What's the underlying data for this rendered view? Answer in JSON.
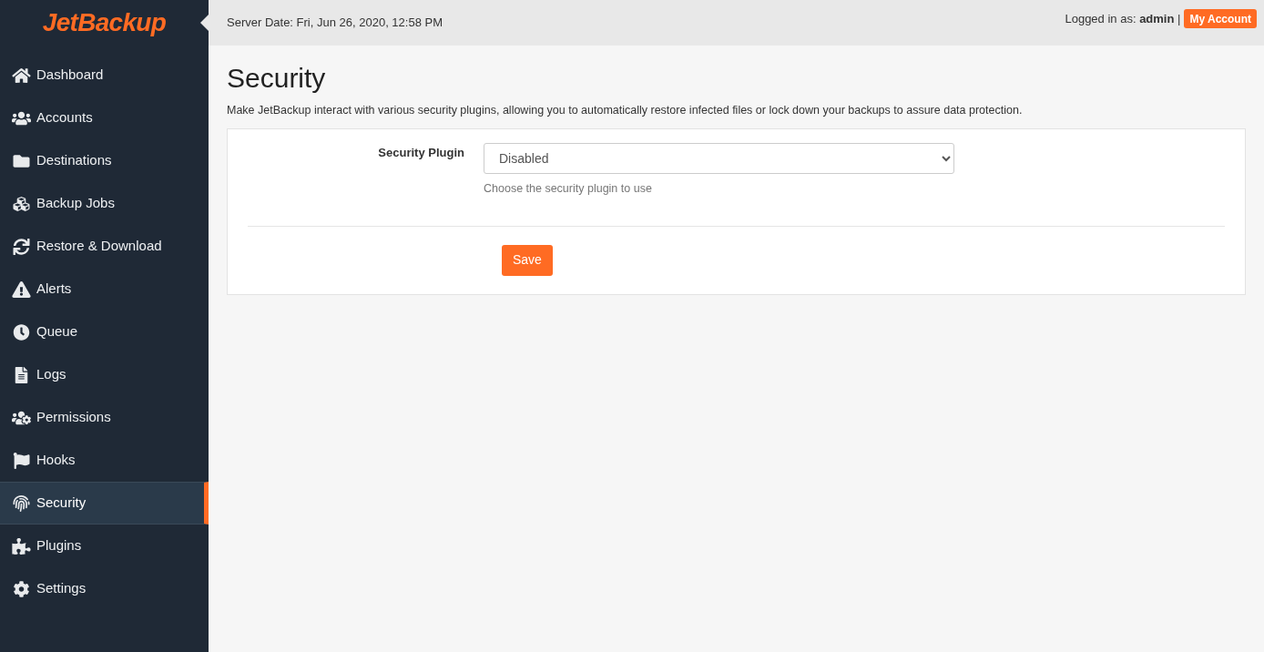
{
  "logo": {
    "text": "JetBackup"
  },
  "sidebar": {
    "items": [
      {
        "label": "Dashboard",
        "selected": false
      },
      {
        "label": "Accounts",
        "selected": false
      },
      {
        "label": "Destinations",
        "selected": false
      },
      {
        "label": "Backup Jobs",
        "selected": false
      },
      {
        "label": "Restore & Download",
        "selected": false
      },
      {
        "label": "Alerts",
        "selected": false
      },
      {
        "label": "Queue",
        "selected": false
      },
      {
        "label": "Logs",
        "selected": false
      },
      {
        "label": "Permissions",
        "selected": false
      },
      {
        "label": "Hooks",
        "selected": false
      },
      {
        "label": "Security",
        "selected": true
      },
      {
        "label": "Plugins",
        "selected": false
      },
      {
        "label": "Settings",
        "selected": false
      }
    ]
  },
  "header": {
    "server_date": "Server Date: Fri, Jun 26, 2020, 12:58 PM",
    "logged_in": "Logged in as: **admin** |",
    "account_button": "My Account"
  },
  "page": {
    "title": "Security",
    "description": "Make JetBackup interact with various security plugins, allowing you to automatically restore infected files or lock down your backups to assure data protection.",
    "form": {
      "label": "Security Plugin",
      "value": "Disabled",
      "help": "Choose the security plugin to use",
      "save": "Save"
    }
  }
}
